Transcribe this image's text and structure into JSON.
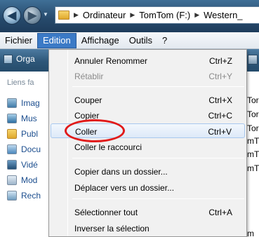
{
  "address": {
    "segments": [
      "Ordinateur",
      "TomTom (F:)",
      "Western_"
    ]
  },
  "menubar": {
    "items": [
      "Fichier",
      "Edition",
      "Affichage",
      "Outils",
      "?"
    ],
    "active": "Edition"
  },
  "toolbar": {
    "organize_label": "Orga"
  },
  "nav": {
    "favorites_header": "Liens fa",
    "items": [
      "Imag",
      "Mus",
      "Publ",
      "Docu",
      "Vidé",
      "Mod",
      "Rech"
    ]
  },
  "filepane": {
    "lines": [
      "Tor",
      "Tor",
      "Tor",
      "mT",
      "mT",
      "mT",
      "m"
    ]
  },
  "edit_menu": {
    "items": [
      {
        "label": "Annuler Renommer",
        "shortcut": "Ctrl+Z",
        "enabled": true
      },
      {
        "label": "Rétablir",
        "shortcut": "Ctrl+Y",
        "enabled": false
      },
      {
        "label": "Couper",
        "shortcut": "Ctrl+X",
        "enabled": true
      },
      {
        "label": "Copier",
        "shortcut": "Ctrl+C",
        "enabled": true
      },
      {
        "label": "Coller",
        "shortcut": "Ctrl+V",
        "enabled": true,
        "highlighted": true
      },
      {
        "label": "Coller le raccourci",
        "shortcut": "",
        "enabled": true
      },
      {
        "label": "Copier dans un dossier...",
        "shortcut": "",
        "enabled": true
      },
      {
        "label": "Déplacer vers un dossier...",
        "shortcut": "",
        "enabled": true
      },
      {
        "label": "Sélectionner tout",
        "shortcut": "Ctrl+A",
        "enabled": true
      },
      {
        "label": "Inverser la sélection",
        "shortcut": "",
        "enabled": true
      }
    ]
  },
  "colors": {
    "annotation": "#e11a1a",
    "menu_highlight": "#3b7ac6"
  }
}
